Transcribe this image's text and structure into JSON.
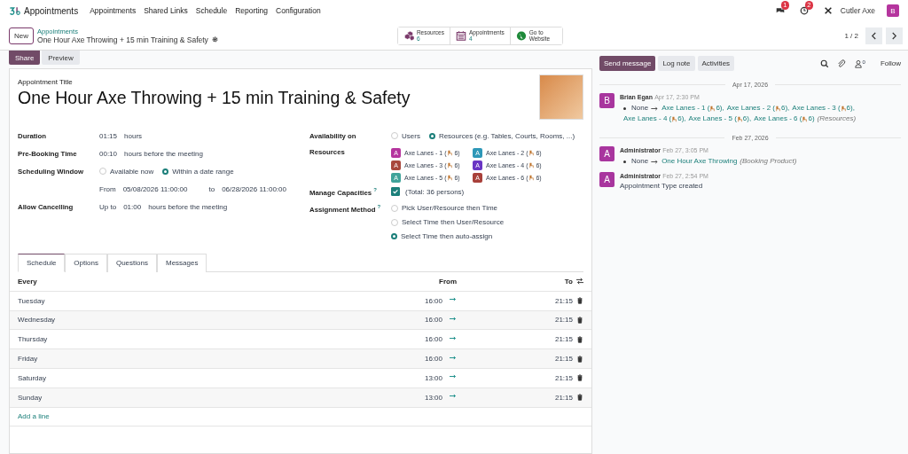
{
  "navbar": {
    "app_name": "Appointments",
    "menu": [
      "Appointments",
      "Shared Links",
      "Schedule",
      "Reporting",
      "Configuration"
    ],
    "messages_badge": "1",
    "activities_badge": "2",
    "company": "Cutler Axe",
    "user_initial": "B"
  },
  "control_panel": {
    "new_button": "New",
    "breadcrumb": "Appointments",
    "record_name": "One Hour Axe Throwing + 15 min Training & Safety",
    "smart_buttons": [
      {
        "kind": "resources",
        "label": "Resources",
        "value": "6"
      },
      {
        "kind": "appointments",
        "label": "Appointments",
        "value": "4"
      },
      {
        "kind": "website",
        "label": "Go to",
        "value": "Website"
      }
    ],
    "pager": "1 / 2"
  },
  "form_buttons": [
    {
      "label": "Share",
      "selected": true
    },
    {
      "label": "Preview",
      "selected": false
    }
  ],
  "form": {
    "title_label": "Appointment Title",
    "title": "One Hour Axe Throwing + 15 min Training & Safety",
    "duration": {
      "label": "Duration",
      "value": "01:15",
      "unit": "hours"
    },
    "pre_booking": {
      "label": "Pre-Booking Time",
      "value": "00:10",
      "unit": "hours before the meeting"
    },
    "scheduling_window": {
      "label": "Scheduling Window",
      "options": [
        {
          "label": "Available now",
          "selected": false
        },
        {
          "label": "Within a date range",
          "selected": true
        }
      ],
      "from_label": "From",
      "from": "05/08/2026 11:00:00",
      "to_label": "to",
      "to": "06/28/2026 11:00:00"
    },
    "allow_cancelling": {
      "label": "Allow Cancelling",
      "prefix": "Up to",
      "value": "01:00",
      "unit": "hours before the meeting"
    },
    "availability_on": {
      "label": "Availability on",
      "options": [
        {
          "label": "Users",
          "selected": false
        },
        {
          "label": "Resources (e.g. Tables, Courts, Rooms, ...)",
          "selected": true
        }
      ]
    },
    "resources": {
      "label": "Resources",
      "tags": [
        {
          "initial": "A",
          "name": "Axe Lanes - 1 (",
          "capacity": "6)",
          "color": "#b5359e"
        },
        {
          "initial": "A",
          "name": "Axe Lanes - 2 (",
          "capacity": "6)",
          "color": "#2e98b8"
        },
        {
          "initial": "A",
          "name": "Axe Lanes - 3 (",
          "capacity": "6)",
          "color": "#a8483d"
        },
        {
          "initial": "A",
          "name": "Axe Lanes - 4 (",
          "capacity": "6)",
          "color": "#6a35c4"
        },
        {
          "initial": "A",
          "name": "Axe Lanes - 5 (",
          "capacity": "6)",
          "color": "#3fa39a"
        },
        {
          "initial": "A",
          "name": "Axe Lanes - 6 (",
          "capacity": "6)",
          "color": "#a8403a"
        }
      ]
    },
    "manage_capacities": {
      "label": "Manage Capacities",
      "help": "?",
      "checked": true,
      "text": "(Total: 36 persons)"
    },
    "assignment_method": {
      "label": "Assignment Method",
      "help": "?",
      "options": [
        {
          "label": "Pick User/Resource then Time",
          "selected": false
        },
        {
          "label": "Select Time then User/Resource",
          "selected": false
        },
        {
          "label": "Select Time then auto-assign",
          "selected": true
        }
      ]
    }
  },
  "tabs": [
    {
      "label": "Schedule",
      "selected": true
    },
    {
      "label": "Options",
      "selected": false
    },
    {
      "label": "Questions",
      "selected": false
    },
    {
      "label": "Messages",
      "selected": false
    }
  ],
  "schedule": {
    "columns": [
      "Every",
      "From",
      "To"
    ],
    "rows": [
      {
        "day": "Tuesday",
        "from": "16:00",
        "to": "21:15"
      },
      {
        "day": "Wednesday",
        "from": "16:00",
        "to": "21:15"
      },
      {
        "day": "Thursday",
        "from": "16:00",
        "to": "21:15"
      },
      {
        "day": "Friday",
        "from": "16:00",
        "to": "21:15"
      },
      {
        "day": "Saturday",
        "from": "13:00",
        "to": "21:15"
      },
      {
        "day": "Sunday",
        "from": "13:00",
        "to": "21:15"
      }
    ],
    "add_line": "Add a line"
  },
  "chatter": {
    "buttons": [
      {
        "label": "Send message",
        "selected": true
      },
      {
        "label": "Log note",
        "selected": false
      },
      {
        "label": "Activities",
        "selected": false
      }
    ],
    "followers_count": "0",
    "follow": "Follow",
    "groups": [
      {
        "date": "Apr 17, 2026",
        "messages": [
          {
            "kind": "tracking",
            "initial": "B",
            "color": "#a8359e",
            "author": "Brian Egan",
            "time": "Apr 17, 2:30 PM",
            "old": "None",
            "links": [
              {
                "name": "Axe Lanes - 1 (",
                "capacity": "6),"
              },
              {
                "name": "Axe Lanes - 2 (",
                "capacity": "6),"
              },
              {
                "name": "Axe Lanes - 3 (",
                "capacity": "6),"
              },
              {
                "name": "Axe Lanes - 4 (",
                "capacity": "6),"
              },
              {
                "name": "Axe Lanes - 5 (",
                "capacity": "6),"
              },
              {
                "name": "Axe Lanes - 6 (",
                "capacity": "6)"
              }
            ],
            "field": "(Resources)"
          }
        ]
      },
      {
        "date": "Feb 27, 2026",
        "messages": [
          {
            "kind": "tracking",
            "initial": "A",
            "color": "#a8359e",
            "author": "Administrator",
            "time": "Feb 27, 3:05 PM",
            "old": "None",
            "links": [
              {
                "name": "One Hour Axe Throwing"
              }
            ],
            "field": "(Booking Product)"
          },
          {
            "kind": "text",
            "initial": "A",
            "color": "#a8359e",
            "author": "Administrator",
            "time": "Feb 27, 2:54 PM",
            "body": "Appointment Type created"
          }
        ]
      }
    ]
  }
}
